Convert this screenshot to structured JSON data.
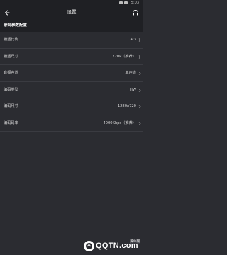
{
  "status_bar": {
    "time": "5:03"
  },
  "toolbar": {
    "title": "设置",
    "back_icon": "back-arrow-icon",
    "right_icon": "headset-icon"
  },
  "section": {
    "title": "录制参数配置"
  },
  "settings": [
    {
      "label": "横竖比例",
      "value": "4:3"
    },
    {
      "label": "横竖尺寸",
      "value": "720P（推荐）"
    },
    {
      "label": "音频声道",
      "value": "单声道"
    },
    {
      "label": "编码类型",
      "value": "HW"
    },
    {
      "label": "编码尺寸",
      "value": "1280x720"
    },
    {
      "label": "编码码率",
      "value": "4000Kbps（推荐）"
    }
  ],
  "watermark": {
    "brand": "QQTN.com",
    "badge": "腾牛网"
  },
  "colors": {
    "background": "#2b2c31",
    "toolbar": "#1f2024",
    "divider": "#3a3b41",
    "text": "#d8d8d8"
  }
}
